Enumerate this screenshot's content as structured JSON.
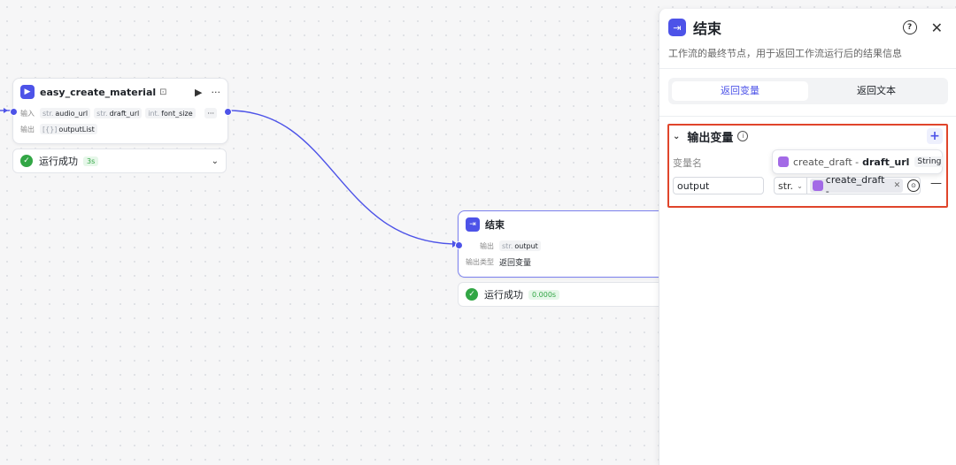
{
  "node1": {
    "title": "easy_create_material",
    "title_suffix": "⊡",
    "input_label": "输入",
    "output_label": "输出",
    "inputs": [
      {
        "type": "str.",
        "name": "audio_url"
      },
      {
        "type": "str.",
        "name": "draft_url"
      },
      {
        "type": "int.",
        "name": "font_size"
      }
    ],
    "outputs": [
      {
        "type": "[{}]",
        "name": "outputList"
      }
    ],
    "status": "运行成功",
    "status_time": "3s"
  },
  "node2": {
    "title": "结束",
    "output_label": "输出",
    "output": {
      "type": "str.",
      "name": "output"
    },
    "output_type_label": "输出类型",
    "output_type_value": "返回变量",
    "status": "运行成功",
    "status_time": "0.000s"
  },
  "panel": {
    "title": "结束",
    "description": "工作流的最终节点，用于返回工作流运行后的结果信息",
    "tabs": [
      {
        "label": "返回变量",
        "active": true
      },
      {
        "label": "返回文本",
        "active": false
      }
    ],
    "section_title": "输出变量",
    "column_label": "变量名",
    "variable_name": "output",
    "ref_type": "str.",
    "ref_chip": "create_draft -",
    "tooltip": {
      "node": "create_draft -",
      "field": "draft_url",
      "type": "String"
    }
  },
  "colors": {
    "accent": "#4d53e8",
    "success": "#32a645",
    "highlight_border": "#e0452b",
    "plugin_purple": "#a36ae6"
  }
}
